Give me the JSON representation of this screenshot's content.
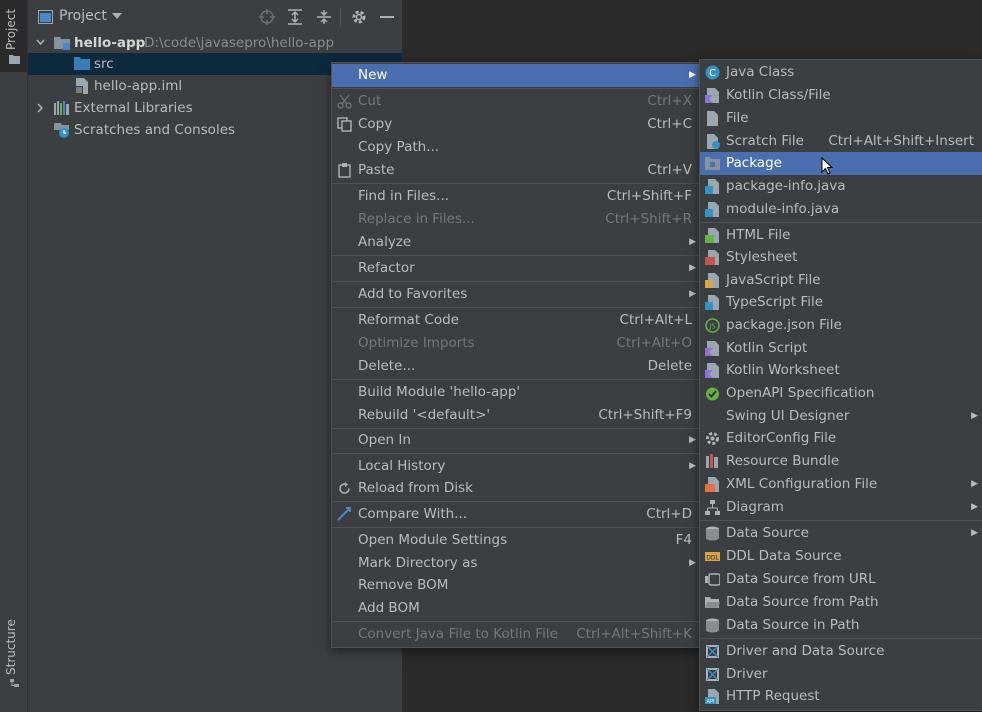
{
  "tool_windows": {
    "project_tab": "Project",
    "structure_tab": "Structure"
  },
  "panel": {
    "title": "Project"
  },
  "tree": {
    "root_name": "hello-app",
    "root_path": "D:\\code\\javasepro\\hello-app",
    "src": "src",
    "iml": "hello-app.iml",
    "external_libraries": "External Libraries",
    "scratches": "Scratches and Consoles"
  },
  "context_menu": {
    "new": "New",
    "cut": "Cut",
    "cut_sc": "Ctrl+X",
    "copy": "Copy",
    "copy_sc": "Ctrl+C",
    "copy_path": "Copy Path...",
    "paste": "Paste",
    "paste_sc": "Ctrl+V",
    "find_in_files": "Find in Files...",
    "find_in_files_sc": "Ctrl+Shift+F",
    "replace_in_files": "Replace in Files...",
    "replace_in_files_sc": "Ctrl+Shift+R",
    "analyze": "Analyze",
    "refactor": "Refactor",
    "add_to_favorites": "Add to Favorites",
    "reformat_code": "Reformat Code",
    "reformat_code_sc": "Ctrl+Alt+L",
    "optimize_imports": "Optimize Imports",
    "optimize_imports_sc": "Ctrl+Alt+O",
    "delete": "Delete...",
    "delete_sc": "Delete",
    "build_module": "Build Module 'hello-app'",
    "rebuild": "Rebuild '<default>'",
    "rebuild_sc": "Ctrl+Shift+F9",
    "open_in": "Open In",
    "local_history": "Local History",
    "reload_from_disk": "Reload from Disk",
    "compare_with": "Compare With...",
    "compare_with_sc": "Ctrl+D",
    "open_module_settings": "Open Module Settings",
    "open_module_settings_sc": "F4",
    "mark_directory_as": "Mark Directory as",
    "remove_bom": "Remove BOM",
    "add_bom": "Add BOM",
    "convert_java": "Convert Java File to Kotlin File",
    "convert_java_sc": "Ctrl+Alt+Shift+K"
  },
  "new_submenu": {
    "java_class": "Java Class",
    "kotlin_class": "Kotlin Class/File",
    "file": "File",
    "scratch_file": "Scratch File",
    "scratch_file_sc": "Ctrl+Alt+Shift+Insert",
    "package": "Package",
    "package_info": "package-info.java",
    "module_info": "module-info.java",
    "html_file": "HTML File",
    "stylesheet": "Stylesheet",
    "javascript_file": "JavaScript File",
    "typescript_file": "TypeScript File",
    "package_json": "package.json File",
    "kotlin_script": "Kotlin Script",
    "kotlin_worksheet": "Kotlin Worksheet",
    "openapi": "OpenAPI Specification",
    "swing_ui": "Swing UI Designer",
    "editorconfig": "EditorConfig File",
    "resource_bundle": "Resource Bundle",
    "xml_config": "XML Configuration File",
    "diagram": "Diagram",
    "data_source": "Data Source",
    "ddl_data_source": "DDL Data Source",
    "ds_from_url": "Data Source from URL",
    "ds_from_path": "Data Source from Path",
    "ds_in_path": "Data Source in Path",
    "driver_and_ds": "Driver and Data Source",
    "driver": "Driver",
    "http_request": "HTTP Request"
  },
  "colors": {
    "panel_bg": "#3c3f41",
    "editor_bg": "#2b2b2b",
    "selection": "#4b6eaf",
    "tree_selection": "#0d293e",
    "text": "#bbbbbb",
    "disabled_text": "#777777"
  }
}
